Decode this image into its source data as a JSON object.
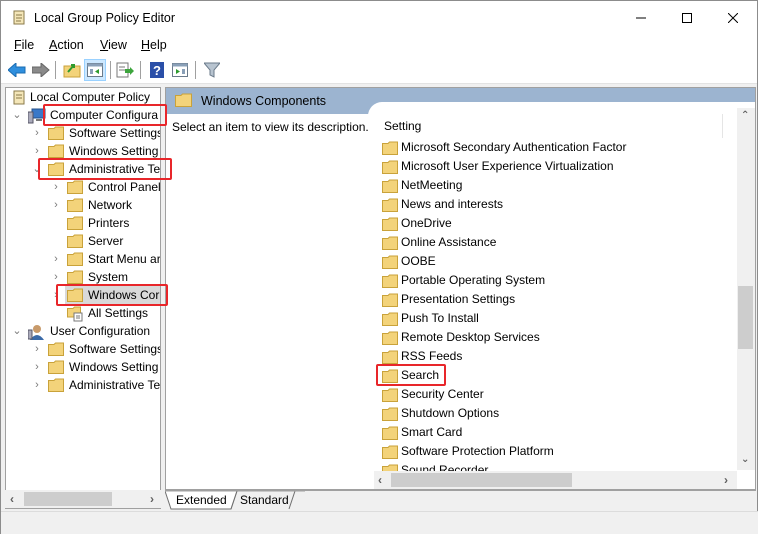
{
  "window": {
    "title": "Local Group Policy Editor",
    "controls": {
      "minimize": "minimize",
      "maximize": "maximize",
      "close": "close"
    }
  },
  "menu": {
    "items": [
      {
        "label": "File",
        "accel": "F",
        "rest": "ile"
      },
      {
        "label": "Action",
        "accel": "A",
        "rest": "ction"
      },
      {
        "label": "View",
        "accel": "V",
        "rest": "iew"
      },
      {
        "label": "Help",
        "accel": "H",
        "rest": "elp"
      }
    ]
  },
  "toolbar": {
    "buttons": [
      "back-arrow-icon",
      "forward-arrow-icon",
      "up-folder-icon",
      "show-hide-console-tree-icon",
      "export-list-icon",
      "help-icon",
      "show-hide-action-pane-icon",
      "filter-icon"
    ]
  },
  "tree": {
    "root": "Local Computer Policy",
    "items": [
      {
        "label": "Computer Configura",
        "level": 1,
        "expanded": true,
        "highlighted": true
      },
      {
        "label": "Software Settings",
        "level": 2,
        "expanded": false
      },
      {
        "label": "Windows Setting",
        "level": 2,
        "expanded": false
      },
      {
        "label": "Administrative Te",
        "level": 2,
        "expanded": true,
        "highlighted": true
      },
      {
        "label": "Control Panel",
        "level": 3,
        "expanded": false
      },
      {
        "label": "Network",
        "level": 3,
        "expanded": false
      },
      {
        "label": "Printers",
        "level": 3
      },
      {
        "label": "Server",
        "level": 3
      },
      {
        "label": "Start Menu ar",
        "level": 3,
        "expanded": false
      },
      {
        "label": "System",
        "level": 3,
        "expanded": false
      },
      {
        "label": "Windows Cor",
        "level": 3,
        "expanded": false,
        "selected": true,
        "highlighted": true
      },
      {
        "label": "All Settings",
        "level": 3
      },
      {
        "label": "User Configuration",
        "level": 1,
        "expanded": true
      },
      {
        "label": "Software Settings",
        "level": 2,
        "expanded": false
      },
      {
        "label": "Windows Setting",
        "level": 2,
        "expanded": false
      },
      {
        "label": "Administrative Te",
        "level": 2,
        "expanded": false
      }
    ]
  },
  "right_pane": {
    "header": "Windows Components",
    "description": "Select an item to view its description.",
    "column_header": "Setting",
    "items": [
      {
        "label": "Microsoft Secondary Authentication Factor"
      },
      {
        "label": "Microsoft User Experience Virtualization"
      },
      {
        "label": "NetMeeting"
      },
      {
        "label": "News and interests"
      },
      {
        "label": "OneDrive"
      },
      {
        "label": "Online Assistance"
      },
      {
        "label": "OOBE"
      },
      {
        "label": "Portable Operating System"
      },
      {
        "label": "Presentation Settings"
      },
      {
        "label": "Push To Install"
      },
      {
        "label": "Remote Desktop Services"
      },
      {
        "label": "RSS Feeds"
      },
      {
        "label": "Search",
        "highlighted": true
      },
      {
        "label": "Security Center"
      },
      {
        "label": "Shutdown Options"
      },
      {
        "label": "Smart Card"
      },
      {
        "label": "Software Protection Platform"
      },
      {
        "label": "Sound Recorder"
      }
    ]
  },
  "tabs": [
    {
      "label": "Extended",
      "active": true
    },
    {
      "label": "Standard",
      "active": false
    }
  ],
  "colors": {
    "highlight_box": "#e8262a",
    "pane_header": "#9cb4d0",
    "folder": "#f3d37a",
    "selection": "#d9d9d9"
  }
}
